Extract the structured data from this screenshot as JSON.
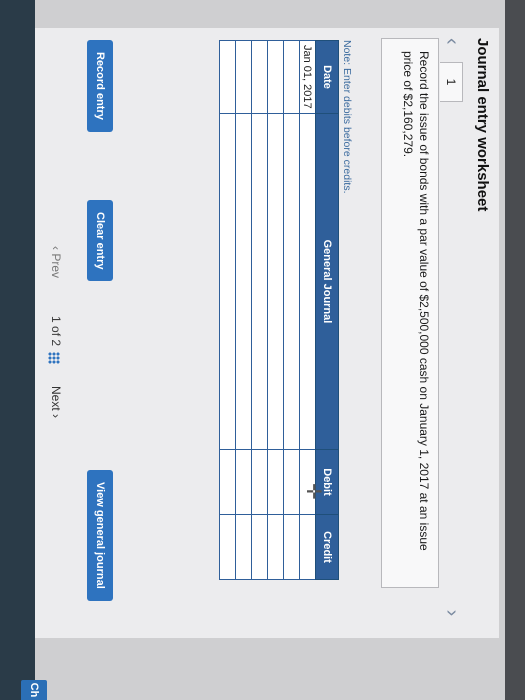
{
  "side_tab": {
    "label": "Ch"
  },
  "worksheet": {
    "title": "Journal entry worksheet",
    "step_number": "1",
    "instruction": "Record the issue of bonds with a par value of $2,500,000 cash on January 1, 2017 at an issue price of $2,160,279.",
    "note": "Note: Enter debits before credits."
  },
  "table": {
    "headers": [
      "Date",
      "General Journal",
      "Debit",
      "Credit"
    ],
    "rows": [
      {
        "date": "Jan 01, 2017",
        "account": "",
        "debit": "",
        "credit": ""
      },
      {
        "date": "",
        "account": "",
        "debit": "",
        "credit": ""
      },
      {
        "date": "",
        "account": "",
        "debit": "",
        "credit": ""
      },
      {
        "date": "",
        "account": "",
        "debit": "",
        "credit": ""
      },
      {
        "date": "",
        "account": "",
        "debit": "",
        "credit": ""
      },
      {
        "date": "",
        "account": "",
        "debit": "",
        "credit": ""
      }
    ]
  },
  "buttons": {
    "record": "Record entry",
    "clear": "Clear entry",
    "view": "View general journal"
  },
  "pager": {
    "prev": "Prev",
    "current": "1",
    "of": "of",
    "total": "2",
    "next": "Next"
  },
  "icons": {
    "prev_chevron": "chevron-left-icon",
    "next_chevron": "chevron-right-icon",
    "grid": "grid-icon",
    "cursor": "crosshair-cursor-icon"
  },
  "colors": {
    "header_blue": "#2f5f9a",
    "button_blue": "#2e73bf",
    "panel_bg": "#ececee"
  }
}
